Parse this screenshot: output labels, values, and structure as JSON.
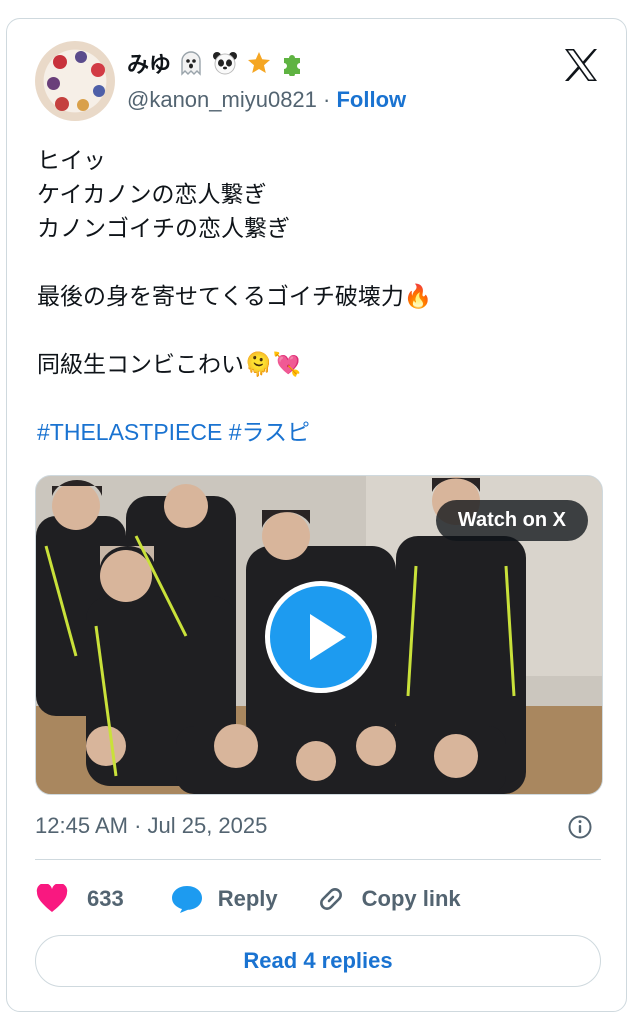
{
  "author": {
    "display_name": "みゆ",
    "name_emojis": [
      "ghost-icon",
      "panda-icon",
      "star-icon",
      "puzzle-icon"
    ],
    "handle": "@kanon_miyu0821",
    "separator": "·",
    "follow_label": "Follow"
  },
  "tweet": {
    "lines": [
      "ヒイッ",
      "ケイカノンの恋人繋ぎ",
      "カノンゴイチの恋人繋ぎ",
      "",
      "最後の身を寄せてくるゴイチ破壊力🔥",
      "",
      "同級生コンビこわい🫠💘",
      ""
    ],
    "hashtags": "#THELASTPIECE #ラスピ"
  },
  "media": {
    "watch_label": "Watch on X",
    "type": "video"
  },
  "meta": {
    "timestamp": "12:45 AM · Jul 25, 2025"
  },
  "actions": {
    "likes": "633",
    "reply_label": "Reply",
    "copy_label": "Copy link"
  },
  "footer": {
    "read_replies_label": "Read 4 replies"
  },
  "colors": {
    "accent": "#1a73d1",
    "like": "#f91880",
    "muted": "#536471",
    "border": "#cfd9de"
  }
}
